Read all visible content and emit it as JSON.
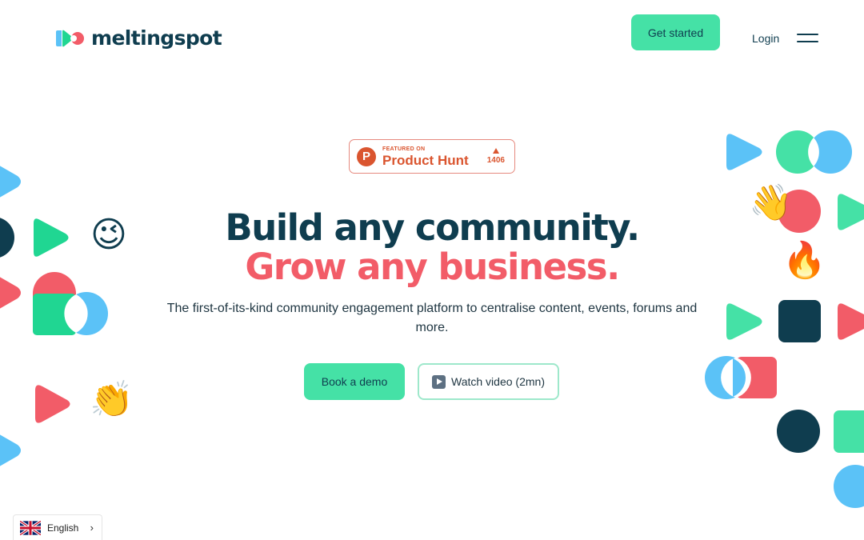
{
  "header": {
    "logo_text": "meltingspot",
    "get_started_label": "Get started",
    "login_label": "Login",
    "menu_icon": "hamburger-menu-icon"
  },
  "product_hunt": {
    "logo_letter": "P",
    "featured_label": "FEATURED ON",
    "name": "Product Hunt",
    "upvote_icon": "upvote-triangle-icon",
    "votes": "1406"
  },
  "hero": {
    "headline_line1": "Build any community.",
    "headline_line2": "Grow any business.",
    "subtitle": "The first-of-its-kind community engagement platform to centralise content, events, forums and more.",
    "book_demo_label": "Book a demo",
    "watch_video_label": "Watch video (2mn)",
    "watch_video_icon": "play-video-icon"
  },
  "decor_emojis": {
    "wink": "😉",
    "clap": "👏",
    "wave": "👋",
    "fire": "🔥"
  },
  "language_selector": {
    "flag_icon": "uk-flag-icon",
    "label": "English",
    "chevron": "›"
  },
  "colors": {
    "navy": "#0f3d4f",
    "green": "#45e1a6",
    "coral": "#f25c68",
    "blue": "#5bc2f7",
    "product_hunt": "#da552f"
  }
}
